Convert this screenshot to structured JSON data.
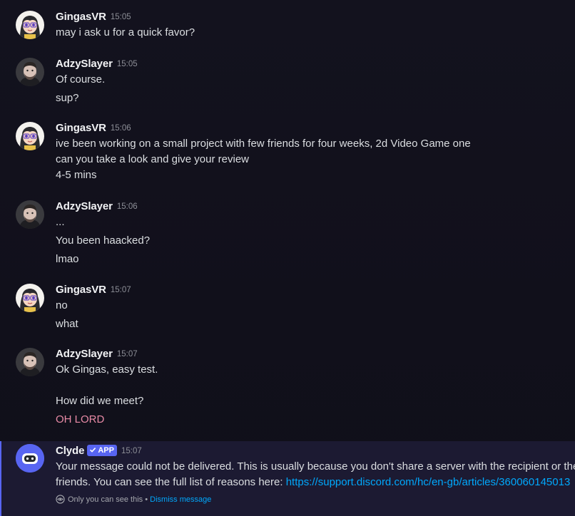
{
  "messages": [
    {
      "user": "GingasVR",
      "time": "15:05",
      "lines": [
        "may i ask u for a quick favor?"
      ]
    },
    {
      "user": "AdzySlayer",
      "time": "15:05",
      "lines": [
        "Of course.",
        "sup?"
      ]
    },
    {
      "user": "GingasVR",
      "time": "15:06",
      "lines": [
        "ive been working on a small project with few friends for four weeks, 2d Video Game one",
        "can you take a look and give your review",
        "4-5 mins"
      ]
    },
    {
      "user": "AdzySlayer",
      "time": "15:06",
      "lines": [
        "...",
        "You been haacked?",
        "lmao"
      ]
    },
    {
      "user": "GingasVR",
      "time": "15:07",
      "lines": [
        "no",
        "what"
      ]
    },
    {
      "user": "AdzySlayer",
      "time": "15:07",
      "lines": [
        "Ok Gingas, easy test.",
        "How did we meet?",
        "OH LORD"
      ]
    }
  ],
  "clyde": {
    "user": "Clyde",
    "badge": "APP",
    "time": "15:07",
    "line1": "Your message could not be delivered. This is usually because you don't share a server with the recipient or the recipient is only accepting direct messages from",
    "line2_prefix": "friends. You can see the full list of reasons here: ",
    "link": "https://support.discord.com/hc/en-gb/articles/360060145013",
    "footer_text": "Only you can see this",
    "footer_sep": " • ",
    "dismiss": "Dismiss message"
  },
  "icons": {
    "gingas_avatar": "anime-girl-avatar-icon",
    "adzy_avatar": "man-portrait-avatar-icon",
    "clyde_avatar": "clyde-robot-icon",
    "badge_check": "verified-check-icon",
    "eye": "eye-icon"
  },
  "colors": {
    "background": "#12111c",
    "username": "#f2f3f5",
    "text": "#dbdee1",
    "timestamp": "#8d8f97",
    "pink_text": "#e88ba6",
    "link": "#00a8fc",
    "accent": "#5865f2"
  }
}
